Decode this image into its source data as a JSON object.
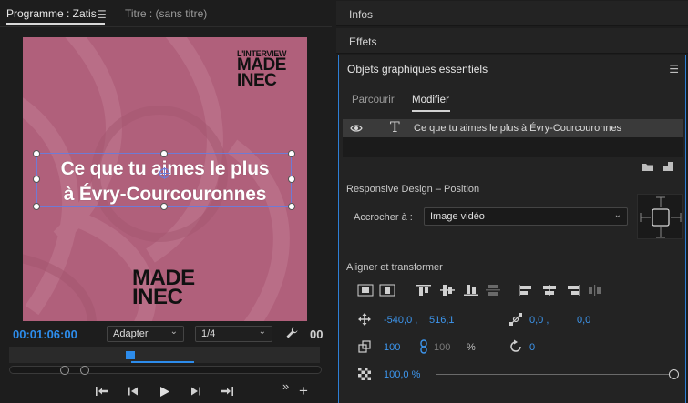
{
  "program_monitor": {
    "tab_program": "Programme : Zatis",
    "tab_title": "Titre : (sans titre)",
    "canvas": {
      "brand_top_small": "L'INTERVIEW",
      "brand_top_line1": "MADE",
      "brand_top_line2": "INEC",
      "text_line1": "Ce que tu aimes le plus",
      "text_line2": "à Évry-Courcouronnes",
      "brand_bottom_line1": "MADE",
      "brand_bottom_line2": "INEC",
      "background_color": "#b0607b"
    },
    "timecode": "00:01:06:00",
    "fit_select": "Adapter",
    "resolution_select": "1/4",
    "right_readout": "00"
  },
  "panels": {
    "infos": "Infos",
    "effets": "Effets"
  },
  "essential_graphics": {
    "title": "Objets graphiques essentiels",
    "tab_browse": "Parcourir",
    "tab_edit": "Modifier",
    "layer_name": "Ce que tu aimes le plus à Évry-Courcouronnes",
    "responsive_design_label": "Responsive Design – Position",
    "pin_to_label": "Accrocher à :",
    "pin_to_value": "Image vidéo",
    "align_transform_label": "Aligner et transformer",
    "position_x": "-540,0 ,",
    "position_y": "516,1",
    "anchor_x": "0,0 ,",
    "anchor_y": "0,0",
    "scale_width": "100",
    "scale_height": "100",
    "scale_unit": "%",
    "rotation": "0",
    "opacity": "100,0 %",
    "opacity_level": 1.0,
    "accent_color": "#2d8ceb"
  }
}
